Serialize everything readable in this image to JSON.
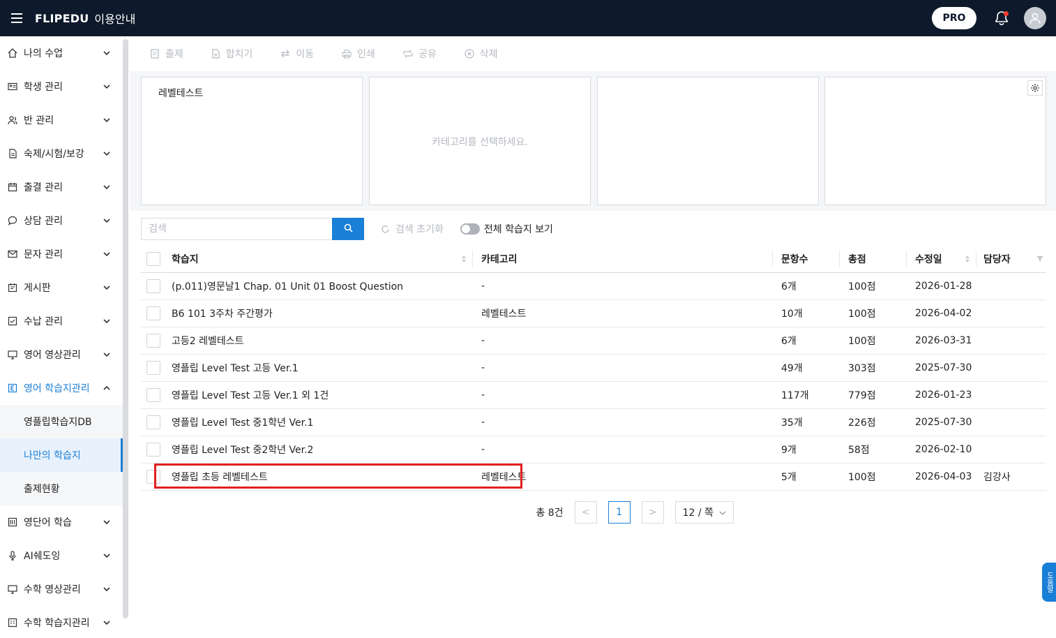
{
  "header": {
    "logo": "FLIPEDU",
    "guide": "이용안내",
    "pro_label": "PRO"
  },
  "sidebar": {
    "items": [
      {
        "label": "나의 수업",
        "icon": "home-icon"
      },
      {
        "label": "학생 관리",
        "icon": "id-card-icon"
      },
      {
        "label": "반 관리",
        "icon": "people-icon"
      },
      {
        "label": "숙제/시험/보강",
        "icon": "document-icon"
      },
      {
        "label": "출결 관리",
        "icon": "calendar-icon"
      },
      {
        "label": "상담 관리",
        "icon": "chat-icon"
      },
      {
        "label": "문자 관리",
        "icon": "mail-icon"
      },
      {
        "label": "게시판",
        "icon": "board-icon"
      },
      {
        "label": "수납 관리",
        "icon": "receipt-icon"
      },
      {
        "label": "영어 영상관리",
        "icon": "monitor-icon"
      },
      {
        "label": "영어 학습지관리",
        "icon": "english-book-icon"
      },
      {
        "label": "영단어 학습",
        "icon": "vocab-icon"
      },
      {
        "label": "AI쉐도잉",
        "icon": "mic-icon"
      },
      {
        "label": "수학 영상관리",
        "icon": "monitor-icon"
      },
      {
        "label": "수학 학습지관리",
        "icon": "math-book-icon"
      }
    ],
    "subitems": [
      "영플립학습지DB",
      "나만의 학습지",
      "출제현황"
    ]
  },
  "toolbar": {
    "publish": "출제",
    "merge": "합치기",
    "move": "이동",
    "print": "인쇄",
    "share": "공유",
    "delete": "삭제"
  },
  "categories": {
    "col1_item": "레벨테스트",
    "placeholder": "카테고리를 선택하세요."
  },
  "search": {
    "placeholder": "검색",
    "value": "",
    "reset_label": "검색 초기화",
    "toggle_label": "전체 학습지 보기",
    "toggle_on": false
  },
  "table": {
    "headers": {
      "name": "학습지",
      "category": "카테고리",
      "count": "문항수",
      "score": "총점",
      "date": "수정일",
      "owner": "담당자"
    },
    "rows": [
      {
        "name": "(p.011)영문날1 Chap. 01 Unit 01 Boost Question",
        "category": "-",
        "count": "6개",
        "score": "100점",
        "date": "2026-01-28",
        "owner": ""
      },
      {
        "name": "B6 101 3주차 주간평가",
        "category": "레벨테스트",
        "count": "10개",
        "score": "100점",
        "date": "2026-04-02",
        "owner": ""
      },
      {
        "name": "고등2 레벨테스트",
        "category": "-",
        "count": "6개",
        "score": "100점",
        "date": "2026-03-31",
        "owner": ""
      },
      {
        "name": "영플립 Level Test 고등 Ver.1",
        "category": "-",
        "count": "49개",
        "score": "303점",
        "date": "2025-07-30",
        "owner": ""
      },
      {
        "name": "영플립 Level Test 고등 Ver.1 외 1건",
        "category": "-",
        "count": "117개",
        "score": "779점",
        "date": "2026-01-23",
        "owner": ""
      },
      {
        "name": "영플립 Level Test 중1학년 Ver.1",
        "category": "-",
        "count": "35개",
        "score": "226점",
        "date": "2025-07-30",
        "owner": ""
      },
      {
        "name": "영플립 Level Test 중2학년 Ver.2",
        "category": "-",
        "count": "9개",
        "score": "58점",
        "date": "2026-02-10",
        "owner": ""
      },
      {
        "name": "영플립 초등 레벨테스트",
        "category": "레벨테스트",
        "count": "5개",
        "score": "100점",
        "date": "2026-04-03",
        "owner": "김강사"
      }
    ]
  },
  "pagination": {
    "total": "총 8건",
    "prev": "<",
    "current": "1",
    "next": ">",
    "per_page": "12 / 쪽"
  },
  "help_tab": "도움말",
  "colors": {
    "header_bg": "#0e1a2b",
    "accent": "#1a7fd6",
    "highlight": "#e02020"
  }
}
